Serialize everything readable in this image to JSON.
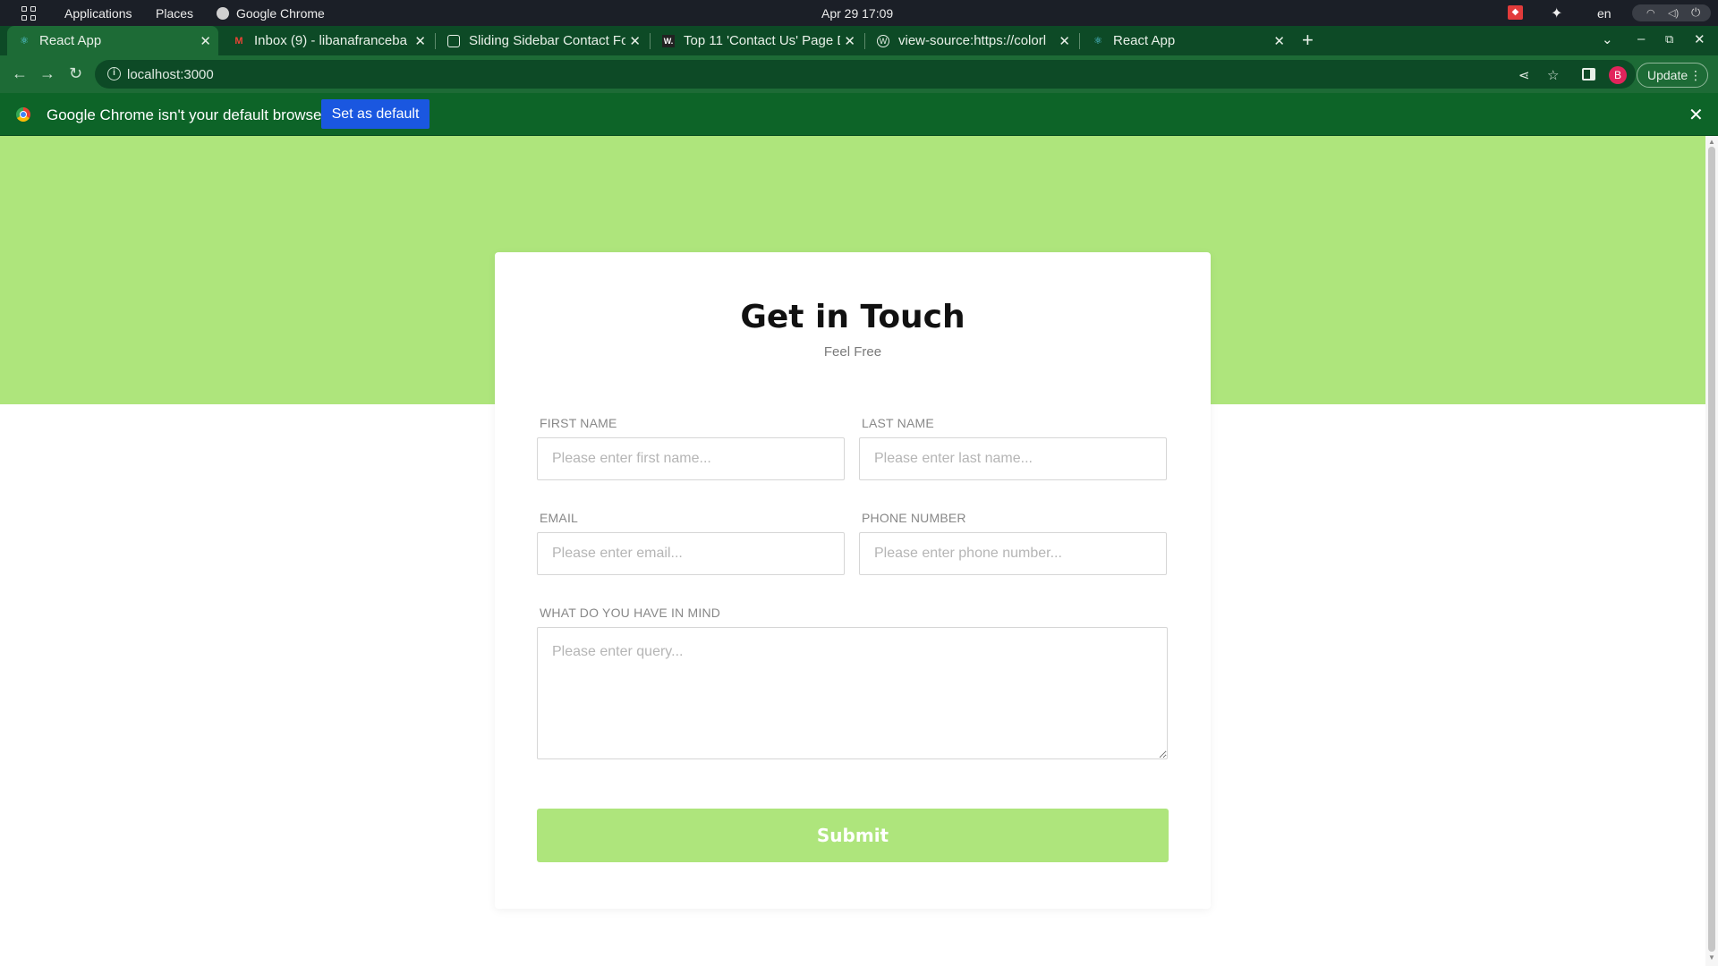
{
  "os": {
    "applications_label": "Applications",
    "places_label": "Places",
    "app_label": "Google Chrome",
    "clock": "Apr 29  17:09",
    "language": "en"
  },
  "browser": {
    "tabs": [
      {
        "label": "React App",
        "favicon": "react-icon",
        "active": true
      },
      {
        "label": "Inbox (9) - libanafranceba",
        "favicon": "gmail-icon",
        "active": false
      },
      {
        "label": "Sliding Sidebar Contact Fo",
        "favicon": "codepen-icon",
        "active": false
      },
      {
        "label": "Top 11 'Contact Us' Page D",
        "favicon": "w-icon",
        "active": false
      },
      {
        "label": "view-source:https://colorl",
        "favicon": "wordpress-icon",
        "active": false
      },
      {
        "label": "React App",
        "favicon": "react-icon",
        "active": false
      }
    ],
    "url": "localhost:3000",
    "profile_initial": "B",
    "update_label": "Update"
  },
  "infobar": {
    "message": "Google Chrome isn't your default browser",
    "button_label": "Set as default"
  },
  "colors": {
    "brand_green": "#aee57c",
    "chrome_green": "#1d6b36",
    "infobar_button": "#1a57e0"
  },
  "form": {
    "title": "Get in Touch",
    "subtitle": "Feel Free",
    "first_name": {
      "label": "FIRST NAME",
      "placeholder": "Please enter first name...",
      "value": ""
    },
    "last_name": {
      "label": "LAST NAME",
      "placeholder": "Please enter last name...",
      "value": ""
    },
    "email": {
      "label": "EMAIL",
      "placeholder": "Please enter email...",
      "value": ""
    },
    "phone": {
      "label": "PHONE NUMBER",
      "placeholder": "Please enter phone number...",
      "value": ""
    },
    "query": {
      "label": "WHAT DO YOU HAVE IN MIND",
      "placeholder": "Please enter query...",
      "value": ""
    },
    "submit_label": "Submit"
  }
}
